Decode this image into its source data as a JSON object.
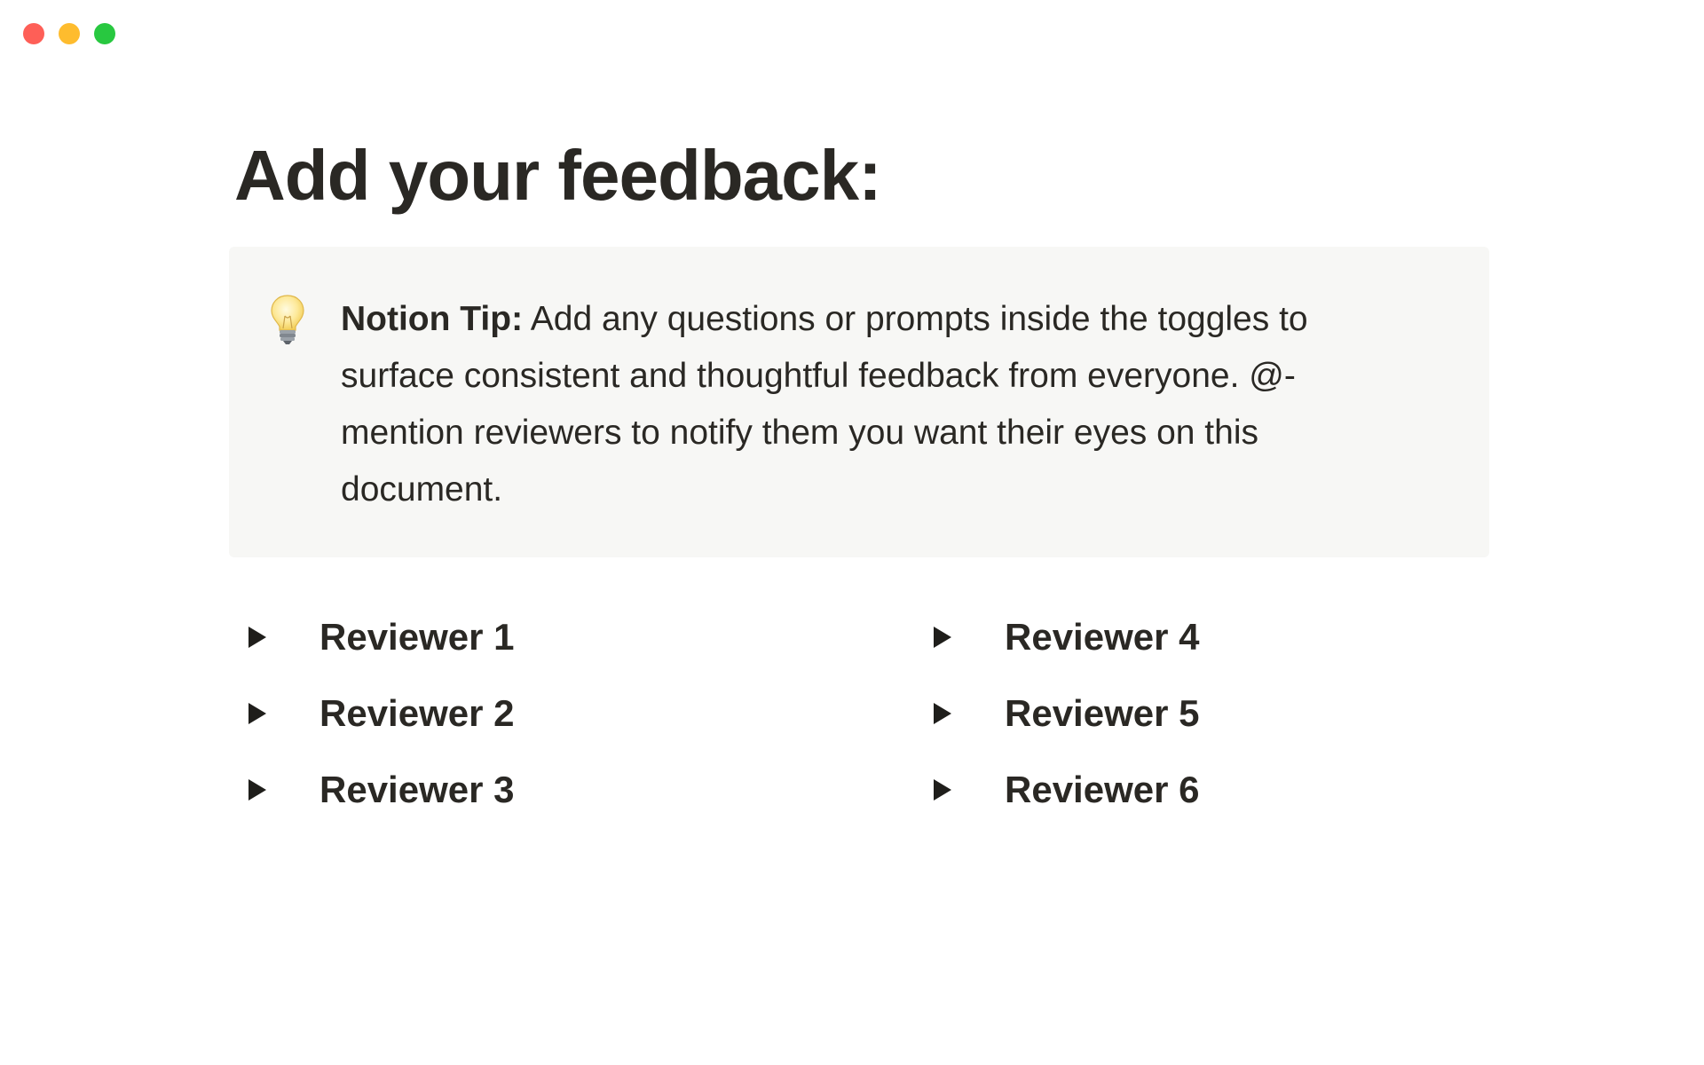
{
  "window": {
    "controls": [
      "close",
      "minimize",
      "maximize"
    ],
    "colors": {
      "close": "#fe5f57",
      "minimize": "#febc2e",
      "maximize": "#28c840"
    }
  },
  "page": {
    "title": "Add your feedback:",
    "callout": {
      "icon": "lightbulb-icon",
      "bold_label": "Notion Tip:",
      "body": " Add any questions or prompts inside the toggles to surface consistent and thoughtful feedback from everyone. @-mention reviewers to notify them you want their eyes on this document.",
      "background": "#f7f7f5"
    },
    "toggles": [
      {
        "label": "Reviewer 1"
      },
      {
        "label": "Reviewer 4"
      },
      {
        "label": "Reviewer 2"
      },
      {
        "label": "Reviewer 5"
      },
      {
        "label": "Reviewer 3"
      },
      {
        "label": "Reviewer 6"
      }
    ]
  }
}
